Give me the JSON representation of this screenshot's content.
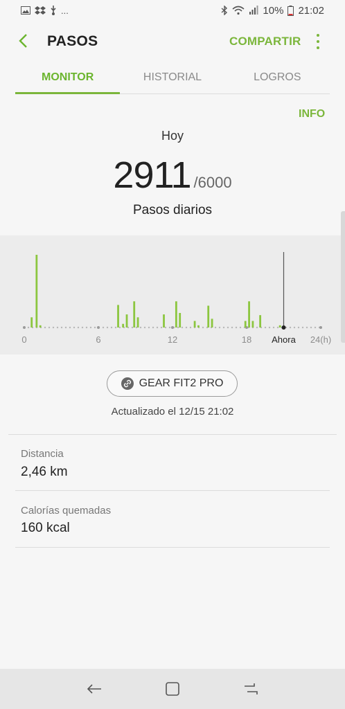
{
  "status_bar": {
    "left_icons": [
      "image-icon",
      "dropbox-icon",
      "usb-icon"
    ],
    "more": "...",
    "battery": "10%",
    "time": "21:02"
  },
  "app_bar": {
    "title": "PASOS",
    "share_label": "COMPARTIR"
  },
  "tabs": [
    {
      "label": "MONITOR",
      "active": true
    },
    {
      "label": "HISTORIAL",
      "active": false
    },
    {
      "label": "LOGROS",
      "active": false
    }
  ],
  "info_label": "INFO",
  "summary": {
    "day": "Hoy",
    "steps": "2911",
    "goal": "/6000",
    "label": "Pasos diarios"
  },
  "chart_data": {
    "type": "bar",
    "x_ticks": [
      "0",
      "6",
      "12",
      "18"
    ],
    "now_label": "Ahora",
    "end_label": "24(h)",
    "now_hour": 21,
    "accent_color": "#8cc63f",
    "bars": [
      {
        "hour": 0.6,
        "value": 14
      },
      {
        "hour": 1.0,
        "value": 100
      },
      {
        "hour": 1.3,
        "value": 3
      },
      {
        "hour": 7.6,
        "value": 31
      },
      {
        "hour": 8.0,
        "value": 5
      },
      {
        "hour": 8.3,
        "value": 18
      },
      {
        "hour": 8.9,
        "value": 36
      },
      {
        "hour": 9.2,
        "value": 14
      },
      {
        "hour": 11.3,
        "value": 18
      },
      {
        "hour": 12.3,
        "value": 36
      },
      {
        "hour": 12.6,
        "value": 20
      },
      {
        "hour": 13.8,
        "value": 9
      },
      {
        "hour": 14.1,
        "value": 3
      },
      {
        "hour": 14.9,
        "value": 30
      },
      {
        "hour": 15.2,
        "value": 12
      },
      {
        "hour": 17.9,
        "value": 9
      },
      {
        "hour": 18.2,
        "value": 36
      },
      {
        "hour": 18.5,
        "value": 9
      },
      {
        "hour": 19.1,
        "value": 17
      },
      {
        "hour": 20.7,
        "value": 3
      }
    ]
  },
  "device": {
    "name": "GEAR FIT2 PRO",
    "updated": "Actualizado el 12/15 21:02"
  },
  "stats": [
    {
      "label": "Distancia",
      "value": "2,46 km"
    },
    {
      "label": "Calorías quemadas",
      "value": "160 kcal"
    }
  ]
}
